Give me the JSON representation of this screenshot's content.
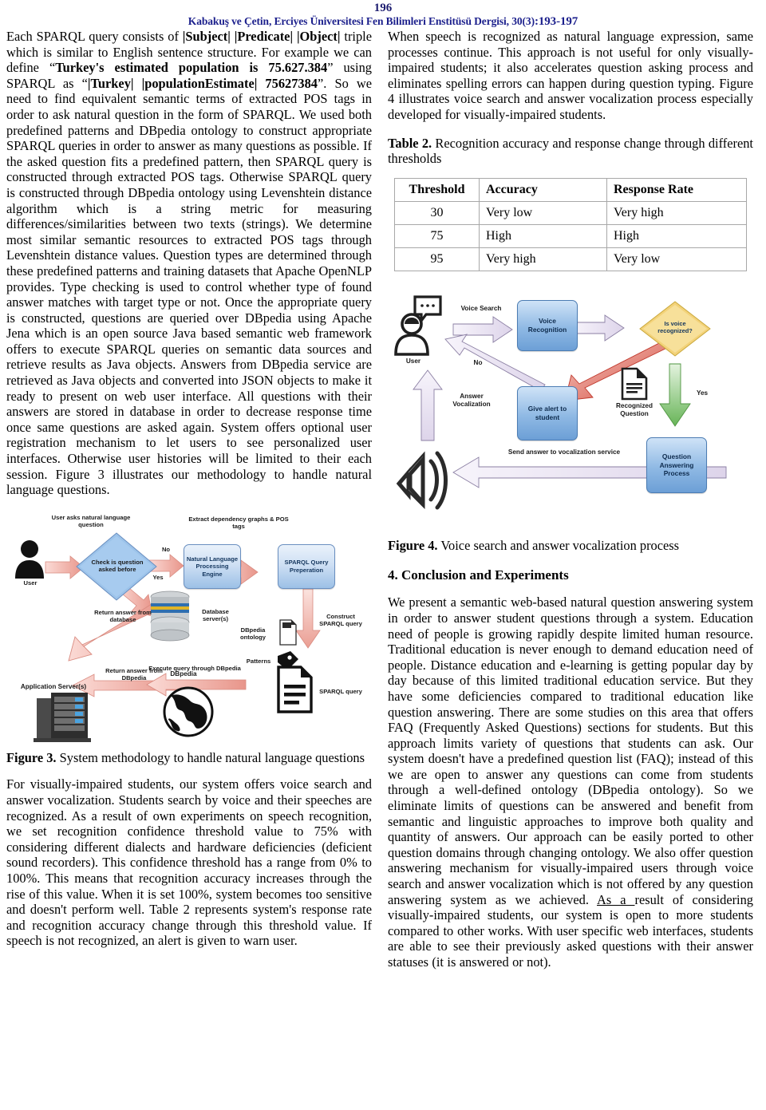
{
  "header": {
    "page_number": "196",
    "running_head_authors": "Kabakuş ve Çetin,",
    "running_head_journal": "Erciyes Üniversitesi Fen Bilimleri Enstitüsü Dergisi, 30(3)",
    "running_head_pages": ":193-197",
    "accent_color": "#1b1f8c"
  },
  "left_column": {
    "para1_a": "Each SPARQL query consists of ",
    "para1_b": "|Subject| |Predicate| |Object|",
    "para1_c": " triple which is similar to English sentence structure. For example we can define “",
    "para1_d": "Turkey's estimated population is 75.627.384",
    "para1_e": "” using SPARQL as “",
    "para1_f": "|Turkey| |populationEstimate| 75627384",
    "para1_g": "”. So we need to find equivalent semantic terms of extracted POS tags in order to ask natural question in the form of SPARQL. We used both predefined patterns and DBpedia ontology to construct appropriate SPARQL queries in order to answer as many questions as possible. If the asked question fits a predefined pattern, then SPARQL query is constructed through extracted POS tags. Otherwise SPARQL query is constructed through DBpedia ontology using Levenshtein distance algorithm which is a string metric for measuring differences/similarities between two texts (strings). We determine most similar semantic resources to extracted POS tags through Levenshtein distance values. Question types are determined through these predefined patterns and training datasets that Apache OpenNLP provides. Type checking is used to control whether type of found answer matches with target type or not. Once the appropriate query is constructed, questions are queried over DBpedia using Apache Jena which is an open source Java based semantic web framework offers to execute SPARQL queries on semantic data sources and retrieve results as Java objects. Answers from DBpedia service are retrieved as Java objects and converted into JSON objects to make it ready to present on web user interface. All questions with their answers are stored in database in order to decrease response time once same questions are asked again. System offers optional user registration mechanism to let users to see personalized user interfaces. Otherwise user histories will be limited to their each session. Figure 3 illustrates our methodology to handle natural language questions.",
    "figure3_caption_lead": "Figure 3.",
    "figure3_caption_text": " System methodology to handle natural language questions",
    "para2": "For visually-impaired students, our system offers voice search and answer vocalization. Students search by voice and their speeches are recognized. As a result of own experiments on speech recognition, we set recognition confidence threshold value to 75% with considering different dialects and hardware deficiencies (deficient sound recorders). This confidence threshold has a range from 0% to 100%. This means that recognition accuracy increases through the rise of this value. When it is set 100%, system becomes too  sensitive and doesn't perform well. Table 2 represents system's response rate and recognition accuracy change through this threshold value. If speech is not recognized, an alert is given to warn user."
  },
  "right_column": {
    "para1": "When speech is recognized as natural language expression, same processes continue. This approach is not useful for only visually-impaired students; it also accelerates question asking process and eliminates spelling errors can happen during question typing. Figure 4 illustrates voice search and answer vocalization process especially developed for visually-impaired students.",
    "table_title_lead": "Table 2.",
    "table_title_text": " Recognition accuracy and response change through different thresholds",
    "figure4_caption_lead": "Figure 4.",
    "figure4_caption_text": " Voice search and answer vocalization process",
    "section_heading": "4. Conclusion and Experiments",
    "para2_a": "We present a semantic web-based natural question answering system in order to answer student questions through a system. Education need of people is growing rapidly despite limited human resource. Traditional education is never enough to demand education need of people. Distance education and e-learning is getting popular day by day because of this limited traditional education service. But they have some deficiencies compared to traditional education like question answering. There are some studies on this area that offers FAQ (Frequently Asked Questions) sections for students. But this approach limits variety of questions that students can ask. Our system doesn't have a predefined question list (FAQ); instead of this we are open to answer any questions can come from students through a well-defined ontology (DBpedia ontology). So we eliminate limits of questions can be answered and benefit from semantic and linguistic approaches to improve both quality and quantity of answers. Our approach can be easily ported to other question domains through changing ontology. We also offer question answering mechanism for visually-impaired users through voice search and answer vocalization which is not offered by any question answering system as we achieved. ",
    "para2_underlined": "As a ",
    "para2_b": "result of considering visually-impaired students, our system is open to more students compared to other works. With user specific web interfaces, students are able to see their previously asked questions with their answer statuses (it is answered or not)."
  },
  "table2": {
    "columns": [
      "Threshold",
      "Accuracy",
      "Response Rate"
    ],
    "rows": [
      [
        "30",
        "Very low",
        "Very high"
      ],
      [
        "75",
        "High",
        "High"
      ],
      [
        "95",
        "Very high",
        "Very low"
      ]
    ]
  },
  "figure3": {
    "label_user": "User",
    "label_ask": "User asks natural language question",
    "label_decision": "Check is question asked before",
    "label_no": "No",
    "label_yes": "Yes",
    "box_nlp": "Natural Language Processing Engine",
    "label_extract": "Extract dependency graphs & POS tags",
    "box_sparql_prep": "SPARQL Query Preperation",
    "label_return_db": "Return answer from database",
    "label_db_server": "Database server(s)",
    "label_app_server": "Application Server(s)",
    "label_return_dbpedia": "Return answer from DBpedia",
    "label_dbpedia": "DBpedia",
    "label_ontology": "DBpedia ontology",
    "label_patterns": "Patterns",
    "label_construct": "Construct SPARQL query",
    "label_execute": "Execute query through DBpedia",
    "label_sparql_query": "SPARQL query"
  },
  "figure4": {
    "label_user": "User",
    "label_voice_search": "Voice Search",
    "box_voice_recognition": "Voice Recognition",
    "diamond_is_recognized": "Is voice recognized?",
    "label_no": "No",
    "label_yes": "Yes",
    "box_give_alert": "Give alert to student",
    "label_recognized_question": "Recognized Question",
    "box_qa_process": "Question Answering Process",
    "label_send_answer": "Send answer to vocalization service",
    "label_answer_vocalization": "Answer Vocalization"
  },
  "colors": {
    "header_blue": "#1b1f8c",
    "arrow_pink": "#f2a8a0",
    "arrow_red": "#e05a4a",
    "arrow_green": "#86c87a",
    "box_blue": "#9cc0e6",
    "diamond_gold": "#f0cf6a",
    "arrow_lilac": "#ece6f4"
  }
}
